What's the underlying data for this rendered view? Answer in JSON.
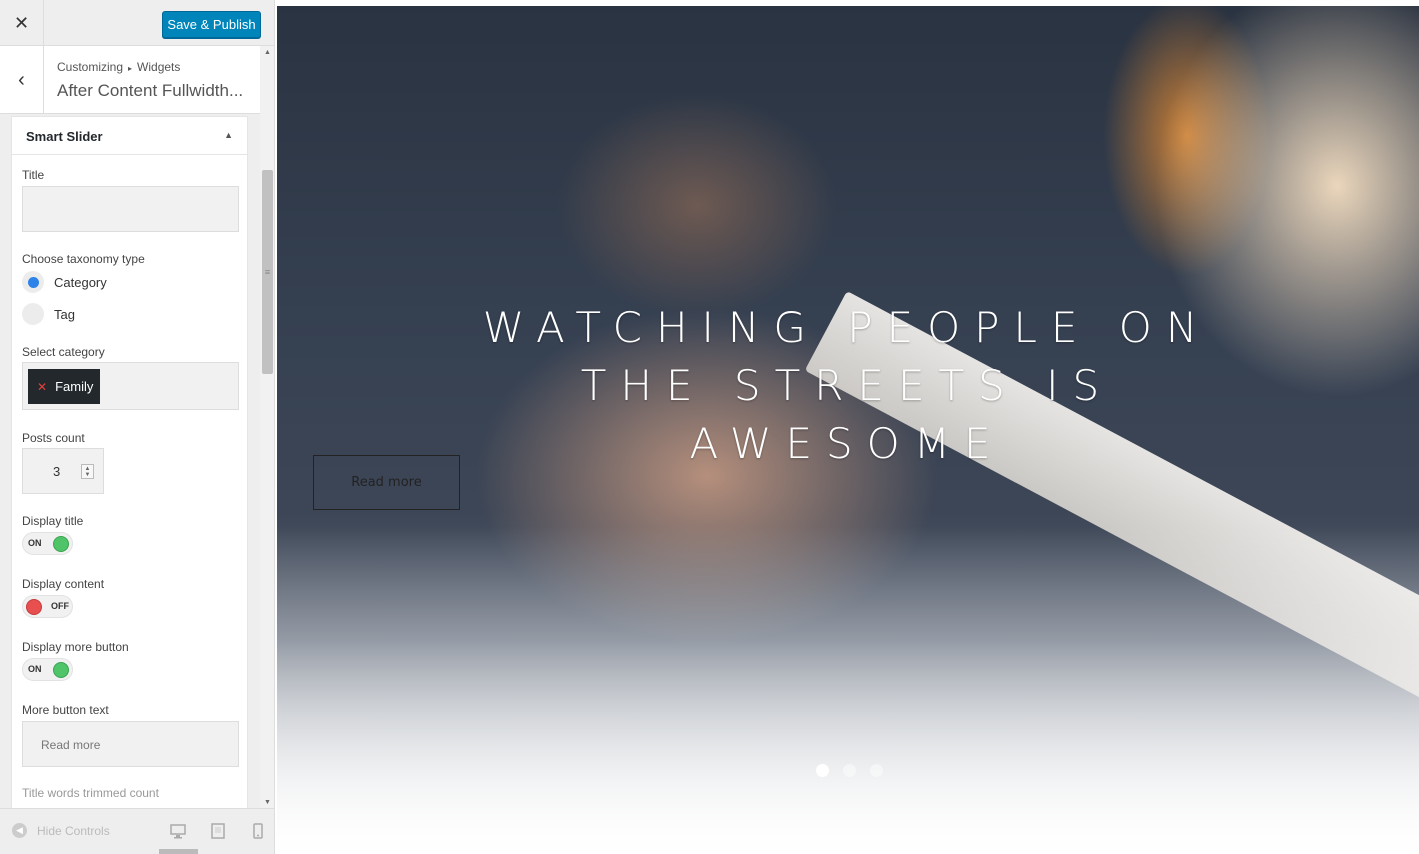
{
  "header": {
    "close_icon": "close-icon",
    "publish_label": "Save & Publish",
    "accent": "#0085ba"
  },
  "section": {
    "breadcrumb_root": "Customizing",
    "breadcrumb_child": "Widgets",
    "title": "After Content Fullwidth..."
  },
  "widget": {
    "name": "Smart Slider",
    "title_label": "Title",
    "title_value": "",
    "taxonomy_label": "Choose taxonomy type",
    "taxonomy_options": [
      {
        "label": "Category",
        "selected": true
      },
      {
        "label": "Tag",
        "selected": false
      }
    ],
    "category_label": "Select category",
    "category_chip": "Family",
    "posts_count_label": "Posts count",
    "posts_count": "3",
    "display_title_label": "Display title",
    "display_title_state": "ON",
    "display_content_label": "Display content",
    "display_content_state": "OFF",
    "display_more_label": "Display more button",
    "display_more_state": "ON",
    "more_text_label": "More button text",
    "more_text_value": "Read more",
    "trim_label": "Title words trimmed count"
  },
  "footer": {
    "hide_controls": "Hide Controls",
    "devices": [
      "desktop",
      "tablet",
      "mobile"
    ],
    "active_device": "desktop"
  },
  "preview": {
    "headline": "WATCHING PEOPLE ON THE STREETS IS AWESOME",
    "button": "Read more",
    "slides": 3,
    "active_slide": 1
  },
  "colors": {
    "on": "#4fc468",
    "off": "#e84f4f",
    "radio": "#2e83e8"
  }
}
